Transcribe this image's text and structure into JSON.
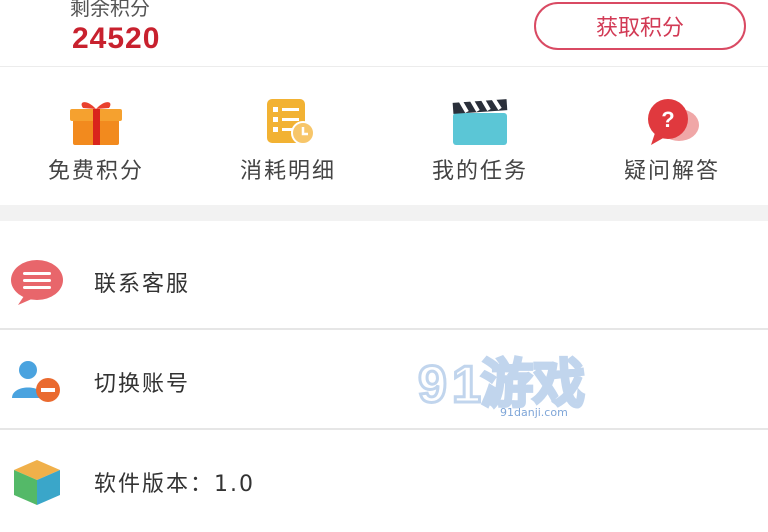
{
  "points": {
    "label": "剩余积分",
    "value": "24520",
    "get_button": "获取积分",
    "value_color": "#c8212e",
    "accent_color": "#d94a63"
  },
  "quick_menu": [
    {
      "label": "免费积分",
      "icon": "gift-icon"
    },
    {
      "label": "消耗明细",
      "icon": "checklist-icon"
    },
    {
      "label": "我的任务",
      "icon": "clapperboard-icon"
    },
    {
      "label": "疑问解答",
      "icon": "question-bubble-icon"
    }
  ],
  "list": [
    {
      "label": "联系客服",
      "icon": "chat-bubble-icon"
    },
    {
      "label": "切换账号",
      "icon": "switch-user-icon"
    },
    {
      "label": "软件版本：1.0",
      "icon": "cube-icon"
    }
  ],
  "watermark": {
    "brand": "91游戏",
    "url": "91danji.com"
  }
}
